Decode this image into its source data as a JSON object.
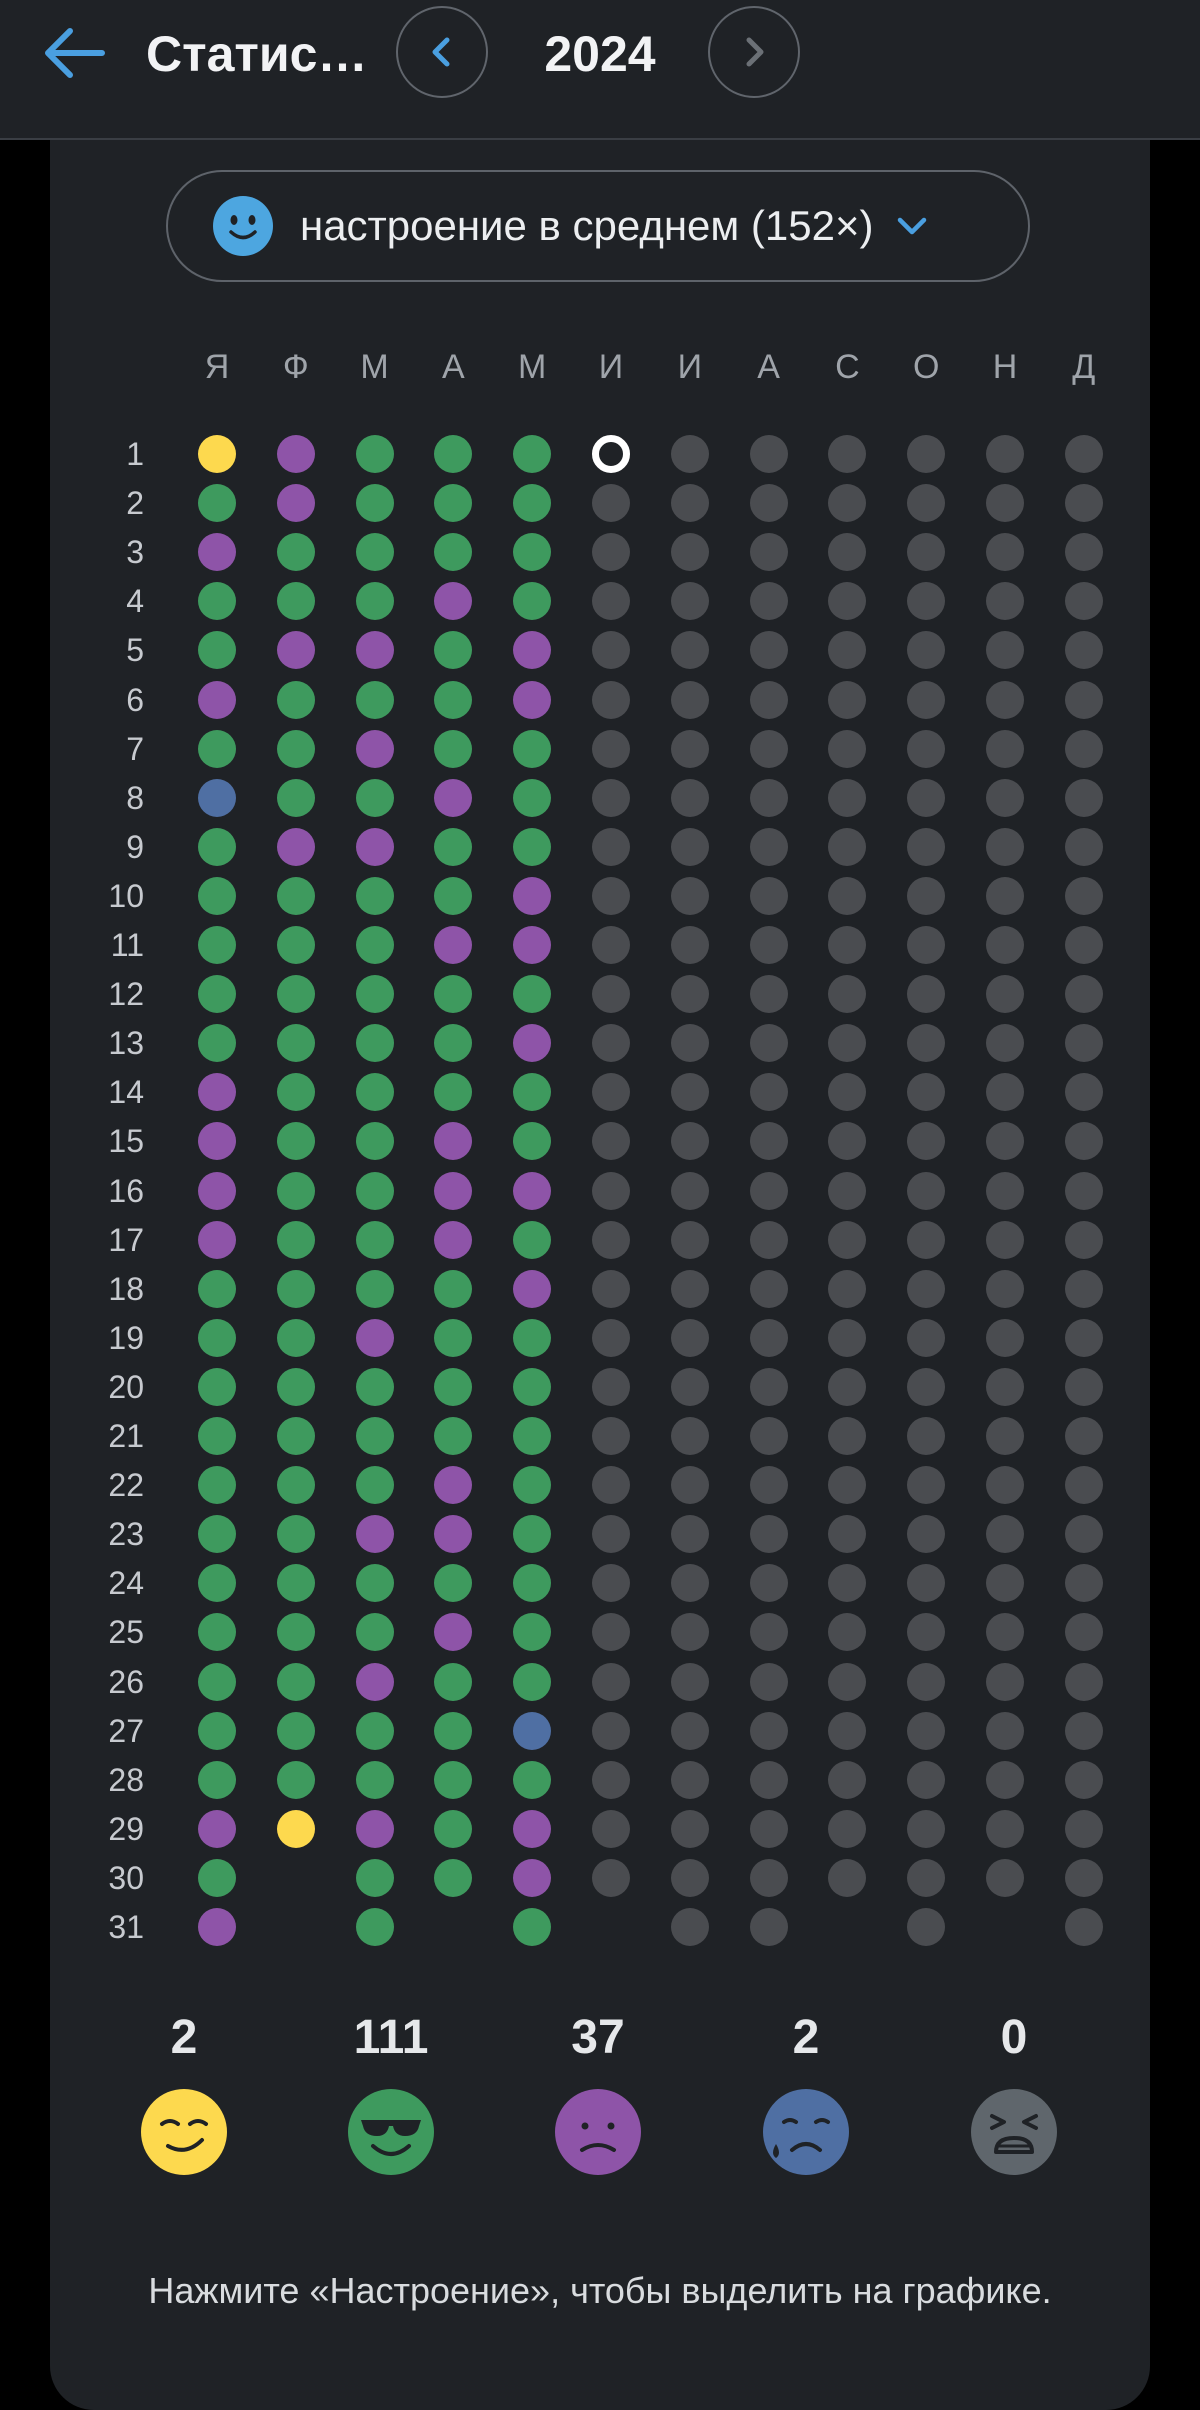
{
  "header": {
    "title": "Статистика",
    "year": "2024",
    "accent": "#4a9fe0"
  },
  "selector": {
    "label": "настроение в среднем (152×)",
    "icon": "smile-face-icon"
  },
  "colors": {
    "1": "#fdd94e",
    "2": "#3e9a5e",
    "3": "#8e54a8",
    "4": "#4f6fa3",
    "5": "#5f666c",
    "empty": "#4a4c50",
    "today": "#ffffff"
  },
  "calendar": {
    "months": [
      "Я",
      "Ф",
      "М",
      "А",
      "М",
      "И",
      "И",
      "А",
      "С",
      "О",
      "Н",
      "Д"
    ],
    "days": [
      "1",
      "2",
      "3",
      "4",
      "5",
      "6",
      "7",
      "8",
      "9",
      "10",
      "11",
      "12",
      "13",
      "14",
      "15",
      "16",
      "17",
      "18",
      "19",
      "20",
      "21",
      "22",
      "23",
      "24",
      "25",
      "26",
      "27",
      "28",
      "29",
      "30",
      "31"
    ],
    "month_lengths": [
      31,
      29,
      31,
      30,
      31,
      30,
      31,
      31,
      30,
      31,
      30,
      31
    ],
    "today": {
      "month": 6,
      "day": 1
    },
    "moods": [
      [
        1,
        2,
        3,
        2,
        2,
        3,
        2,
        4,
        2,
        2,
        2,
        2,
        2,
        3,
        3,
        3,
        3,
        2,
        2,
        2,
        2,
        2,
        2,
        2,
        2,
        2,
        2,
        2,
        3,
        2,
        3
      ],
      [
        3,
        3,
        2,
        2,
        3,
        2,
        2,
        2,
        3,
        2,
        2,
        2,
        2,
        2,
        2,
        2,
        2,
        2,
        2,
        2,
        2,
        2,
        2,
        2,
        2,
        2,
        2,
        2,
        1
      ],
      [
        2,
        2,
        2,
        2,
        3,
        2,
        3,
        2,
        3,
        2,
        2,
        2,
        2,
        2,
        2,
        2,
        2,
        2,
        3,
        2,
        2,
        2,
        3,
        2,
        2,
        3,
        2,
        2,
        3,
        2,
        2
      ],
      [
        2,
        2,
        2,
        3,
        2,
        2,
        2,
        3,
        2,
        2,
        3,
        2,
        2,
        2,
        3,
        3,
        3,
        2,
        2,
        2,
        2,
        3,
        3,
        2,
        3,
        2,
        2,
        2,
        2,
        2
      ],
      [
        2,
        2,
        2,
        2,
        3,
        3,
        2,
        2,
        2,
        3,
        3,
        2,
        3,
        2,
        2,
        3,
        2,
        3,
        2,
        2,
        2,
        2,
        2,
        2,
        2,
        2,
        4,
        2,
        3,
        3,
        2
      ]
    ]
  },
  "stats": [
    {
      "count": "2",
      "color": "#fdd94e",
      "icon": "smirk-face-icon"
    },
    {
      "count": "111",
      "color": "#3e9a5e",
      "icon": "sunglasses-face-icon"
    },
    {
      "count": "37",
      "color": "#8e54a8",
      "icon": "frown-face-icon"
    },
    {
      "count": "2",
      "color": "#4f6fa3",
      "icon": "sad-tear-face-icon"
    },
    {
      "count": "0",
      "color": "#5f666c",
      "icon": "weary-face-icon"
    }
  ],
  "hint": "Нажмите «Настроение», чтобы выделить на графике."
}
